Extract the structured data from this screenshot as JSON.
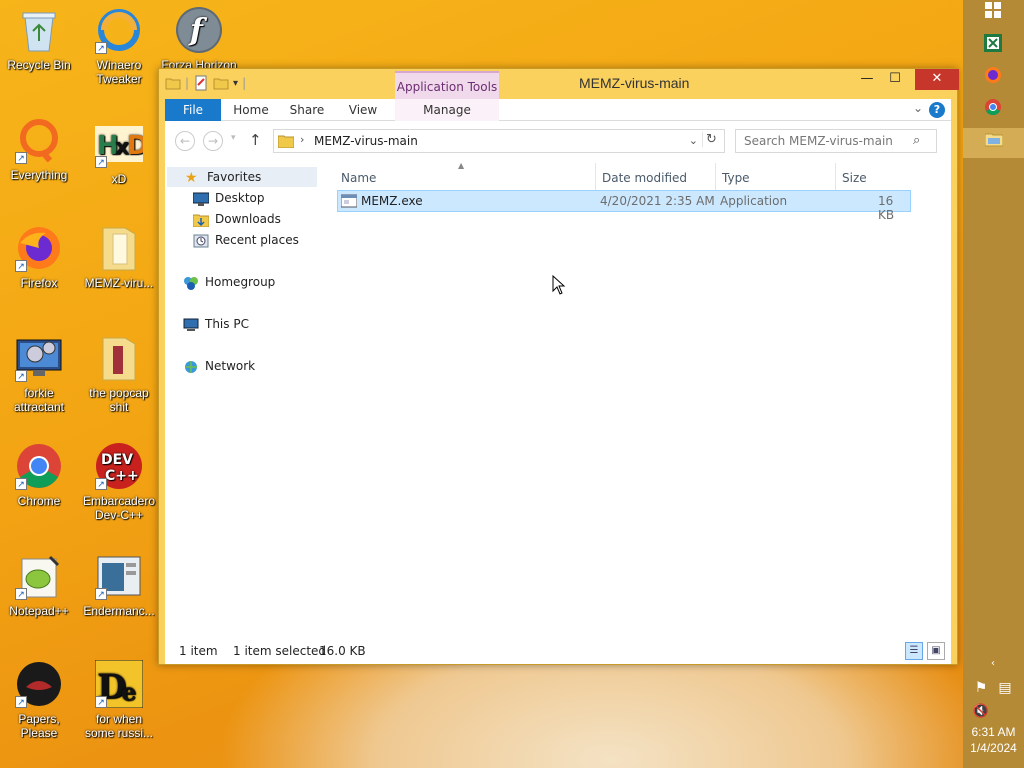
{
  "desktop": {
    "icons": [
      {
        "label": "Recycle Bin",
        "icon": "recycle-bin-icon"
      },
      {
        "label": "Winaero Tweaker",
        "icon": "winaero-tweaker-icon"
      },
      {
        "label": "Forza Horizon",
        "icon": "flash-icon"
      },
      {
        "label": "Everything",
        "icon": "everything-icon"
      },
      {
        "label": "xD",
        "icon": "hxd-icon"
      },
      {
        "label": "Firefox",
        "icon": "firefox-icon"
      },
      {
        "label": "MEMZ-viru...",
        "icon": "folder-icon"
      },
      {
        "label": "forkie attractant",
        "icon": "control-panel-icon"
      },
      {
        "label": "the popcap shit",
        "icon": "folder-icon"
      },
      {
        "label": "Chrome",
        "icon": "chrome-icon"
      },
      {
        "label": "Embarcadero Dev-C++",
        "icon": "devcpp-icon"
      },
      {
        "label": "Notepad++",
        "icon": "notepadpp-icon"
      },
      {
        "label": "Endermanc...",
        "icon": "endermanch-icon"
      },
      {
        "label": "Papers, Please",
        "icon": "papers-please-icon"
      },
      {
        "label": "for when some russi...",
        "icon": "de-icon"
      }
    ]
  },
  "window": {
    "title": "MEMZ-virus-main",
    "context_tab": "Application Tools",
    "controls": {
      "minimize": "—",
      "maximize": "☐",
      "close": "✕"
    },
    "ribbon_tabs": [
      "File",
      "Home",
      "Share",
      "View",
      "Manage"
    ],
    "help": "?",
    "nav": {
      "back": "←",
      "forward": "→",
      "up": "↑"
    },
    "address": {
      "breadcrumb": "MEMZ-virus-main"
    },
    "search": {
      "placeholder": "Search MEMZ-virus-main"
    },
    "nav_pane": {
      "favorites": "Favorites",
      "favorites_items": [
        "Desktop",
        "Downloads",
        "Recent places"
      ],
      "homegroup": "Homegroup",
      "this_pc": "This PC",
      "network": "Network"
    },
    "columns": {
      "name": "Name",
      "date": "Date modified",
      "type": "Type",
      "size": "Size"
    },
    "files": [
      {
        "name": "MEMZ.exe",
        "date": "4/20/2021 2:35 AM",
        "type": "Application",
        "size": "16 KB",
        "selected": true
      }
    ],
    "status": {
      "count": "1 item",
      "selection": "1 item selected",
      "size": "16.0 KB"
    }
  },
  "taskbar": {
    "pinned": [
      "windows-start-icon",
      "excel-icon",
      "firefox-icon",
      "chrome-icon",
      "file-explorer-icon"
    ],
    "time": "6:31 AM",
    "date": "1/4/2024"
  },
  "colors": {
    "desktop": "#f3a513",
    "window_frame": "#fbd15e",
    "file_tab": "#1979ca",
    "selection": "#cce8ff",
    "taskbar": "#b58a36",
    "close_button": "#c7362a"
  }
}
